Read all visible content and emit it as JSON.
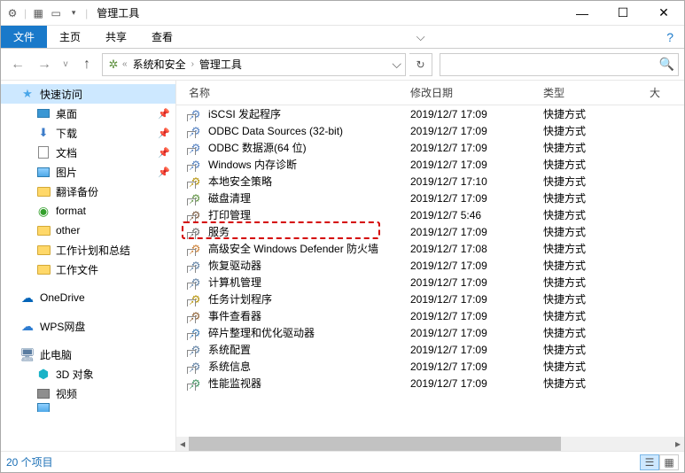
{
  "titlebar": {
    "title": "管理工具",
    "sep": "|"
  },
  "ribbon": {
    "file": "文件",
    "home": "主页",
    "share": "共享",
    "view": "查看",
    "help": "?"
  },
  "nav": {
    "dropdown": "v"
  },
  "breadcrumb": {
    "items": [
      "系统和安全",
      "管理工具"
    ],
    "sep": "›",
    "prefix_sep": "«"
  },
  "search": {
    "placeholder": ""
  },
  "columns": {
    "name": "名称",
    "date": "修改日期",
    "type": "类型",
    "size": "大"
  },
  "sidebar": {
    "quick_access": "快速访问",
    "desktop": "桌面",
    "downloads": "下载",
    "documents": "文档",
    "pictures": "图片",
    "fanyi": "翻译备份",
    "format": "format",
    "other": "other",
    "workplan": "工作计划和总结",
    "workfiles": "工作文件",
    "onedrive": "OneDrive",
    "wps": "WPS网盘",
    "thispc": "此电脑",
    "obj3d": "3D 对象",
    "videos": "视频"
  },
  "files": [
    {
      "name": "iSCSI 发起程序",
      "date": "2019/12/7 17:09",
      "type": "快捷方式",
      "highlight": false
    },
    {
      "name": "ODBC Data Sources (32-bit)",
      "date": "2019/12/7 17:09",
      "type": "快捷方式",
      "highlight": false
    },
    {
      "name": "ODBC 数据源(64 位)",
      "date": "2019/12/7 17:09",
      "type": "快捷方式",
      "highlight": false
    },
    {
      "name": "Windows 内存诊断",
      "date": "2019/12/7 17:09",
      "type": "快捷方式",
      "highlight": false
    },
    {
      "name": "本地安全策略",
      "date": "2019/12/7 17:10",
      "type": "快捷方式",
      "highlight": false
    },
    {
      "name": "磁盘清理",
      "date": "2019/12/7 17:09",
      "type": "快捷方式",
      "highlight": false
    },
    {
      "name": "打印管理",
      "date": "2019/12/7 5:46",
      "type": "快捷方式",
      "highlight": false
    },
    {
      "name": "服务",
      "date": "2019/12/7 17:09",
      "type": "快捷方式",
      "highlight": true
    },
    {
      "name": "高级安全 Windows Defender 防火墙",
      "date": "2019/12/7 17:08",
      "type": "快捷方式",
      "highlight": false
    },
    {
      "name": "恢复驱动器",
      "date": "2019/12/7 17:09",
      "type": "快捷方式",
      "highlight": false
    },
    {
      "name": "计算机管理",
      "date": "2019/12/7 17:09",
      "type": "快捷方式",
      "highlight": false
    },
    {
      "name": "任务计划程序",
      "date": "2019/12/7 17:09",
      "type": "快捷方式",
      "highlight": false
    },
    {
      "name": "事件查看器",
      "date": "2019/12/7 17:09",
      "type": "快捷方式",
      "highlight": false
    },
    {
      "name": "碎片整理和优化驱动器",
      "date": "2019/12/7 17:09",
      "type": "快捷方式",
      "highlight": false
    },
    {
      "name": "系统配置",
      "date": "2019/12/7 17:09",
      "type": "快捷方式",
      "highlight": false
    },
    {
      "name": "系统信息",
      "date": "2019/12/7 17:09",
      "type": "快捷方式",
      "highlight": false
    },
    {
      "name": "性能监视器",
      "date": "2019/12/7 17:09",
      "type": "快捷方式",
      "highlight": false
    }
  ],
  "status": {
    "count": "20 个项目"
  }
}
